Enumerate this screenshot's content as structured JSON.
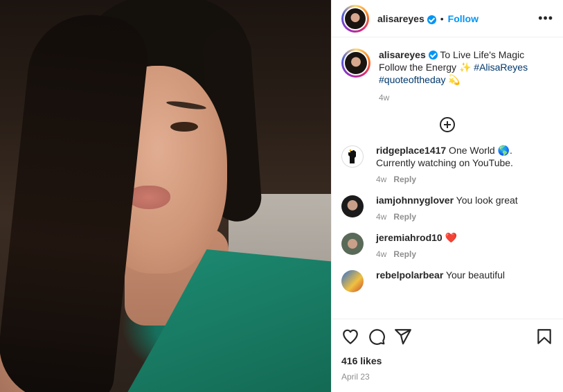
{
  "post": {
    "username": "alisareyes",
    "dot": "•",
    "follow_label": "Follow",
    "more_label": "•••"
  },
  "caption": {
    "username": "alisareyes",
    "text_1": " To Live Life's Magic Follow the Energy ✨",
    "hashtag_1": "#AlisaReyes",
    "hashtag_2": "#quoteoftheday",
    "emoji_end": " 💫",
    "time": "4w"
  },
  "comments": [
    {
      "username": "ridgeplace1417",
      "text": " One World 🌎. Currently watching on YouTube.",
      "time": "4w",
      "reply": "Reply"
    },
    {
      "username": "iamjohnnyglover",
      "text": " You look great",
      "time": "4w",
      "reply": "Reply"
    },
    {
      "username": "jeremiahrod10",
      "text": " ❤️",
      "time": "4w",
      "reply": "Reply"
    },
    {
      "username": "rebelpolarbear",
      "text": " Your beautiful",
      "time": "",
      "reply": ""
    }
  ],
  "footer": {
    "likes": "416 likes",
    "date": "April 23"
  },
  "colors": {
    "accent": "#0095f6",
    "hashtag": "#00376b",
    "muted": "#8e8e8e"
  },
  "icons": [
    "verified-badge-icon",
    "more-icon",
    "add-comment-icon",
    "heart-icon",
    "comment-icon",
    "share-icon",
    "bookmark-icon"
  ]
}
